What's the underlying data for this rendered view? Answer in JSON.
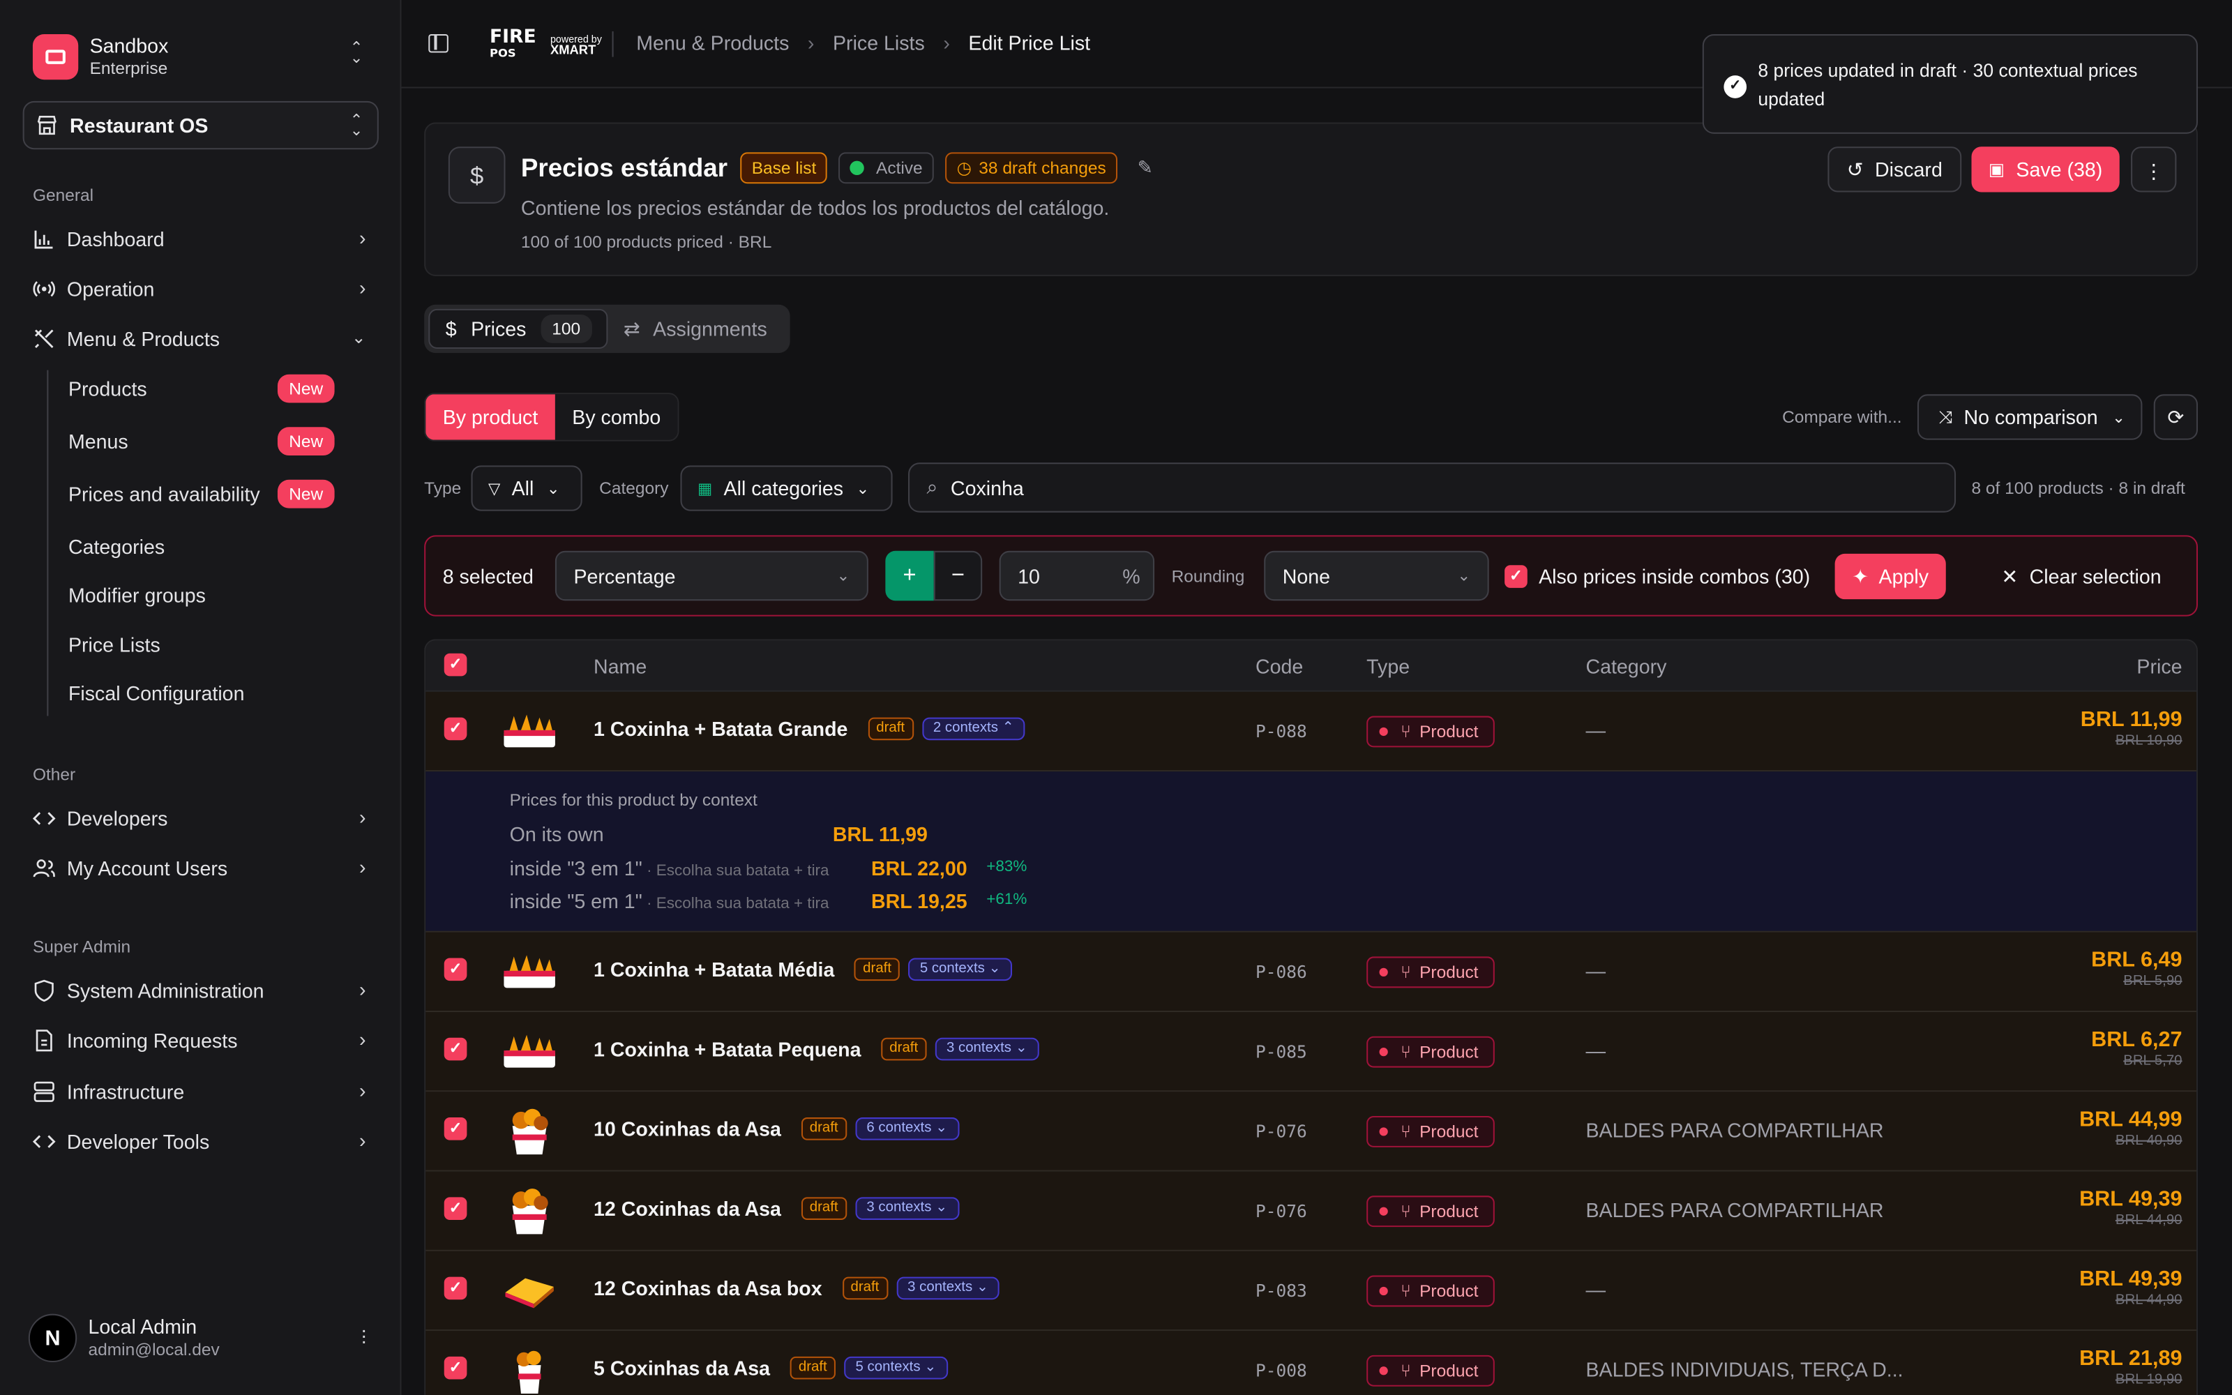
{
  "sidebar": {
    "org_name": "Sandbox",
    "org_plan": "Enterprise",
    "workspace": "Restaurant OS",
    "sections": {
      "general": "General",
      "other": "Other",
      "super_admin": "Super Admin"
    },
    "items": {
      "dashboard": "Dashboard",
      "operation": "Operation",
      "menu_products": "Menu & Products",
      "developers": "Developers",
      "my_account_users": "My Account Users",
      "system_administration": "System Administration",
      "incoming_requests": "Incoming Requests",
      "infrastructure": "Infrastructure",
      "developer_tools": "Developer Tools"
    },
    "subitems": {
      "products": "Products",
      "menus": "Menus",
      "prices_availability": "Prices and availability",
      "categories": "Categories",
      "modifier_groups": "Modifier groups",
      "price_lists": "Price Lists",
      "fiscal_configuration": "Fiscal Configuration"
    },
    "new_badge": "New",
    "user": {
      "name": "Local Admin",
      "email": "admin@local.dev",
      "initial": "N"
    }
  },
  "topbar": {
    "brand": {
      "fire": "FIRE",
      "pos": "POS",
      "powered": "powered by",
      "xmart": "XMART"
    },
    "breadcrumbs": [
      "Menu & Products",
      "Price Lists",
      "Edit Price List"
    ]
  },
  "toast": {
    "message": "8 prices updated in draft · 30 contextual prices updated"
  },
  "header": {
    "icon": "$",
    "title": "Precios estándar",
    "badge_base": "Base list",
    "badge_active": "Active",
    "badge_draft": "38 draft changes",
    "description": "Contiene los precios estándar de todos los productos del catálogo.",
    "meta": "100 of 100 products priced · BRL",
    "discard": "Discard",
    "save": "Save (38)"
  },
  "tabs": {
    "prices": "Prices",
    "prices_count": "100",
    "assignments": "Assignments"
  },
  "view": {
    "by_product": "By product",
    "by_combo": "By combo",
    "compare_label": "Compare with...",
    "compare_value": "No comparison"
  },
  "filters": {
    "type_label": "Type",
    "type_value": "All",
    "category_label": "Category",
    "category_value": "All categories",
    "search_value": "Coxinha",
    "count": "8 of 100 products · 8 in draft"
  },
  "bulk": {
    "selected": "8 selected",
    "mode": "Percentage",
    "plus": "+",
    "minus": "−",
    "amount": "10",
    "unit": "%",
    "rounding_label": "Rounding",
    "rounding_value": "None",
    "also_combos": "Also prices inside combos (30)",
    "apply": "Apply",
    "clear": "Clear selection"
  },
  "table": {
    "headers": {
      "name": "Name",
      "code": "Code",
      "type": "Type",
      "category": "Category",
      "price": "Price"
    },
    "draft_label": "draft",
    "rows": [
      {
        "name": "1 Coxinha + Batata Grande",
        "contexts": "2 contexts",
        "code": "P-088",
        "type": "Product",
        "category": "—",
        "price": "BRL 11,99",
        "old_price": "BRL 10,90"
      },
      {
        "name": "1 Coxinha + Batata Média",
        "contexts": "5 contexts",
        "code": "P-086",
        "type": "Product",
        "category": "—",
        "price": "BRL 6,49",
        "old_price": "BRL 5,90"
      },
      {
        "name": "1 Coxinha + Batata Pequena",
        "contexts": "3 contexts",
        "code": "P-085",
        "type": "Product",
        "category": "—",
        "price": "BRL 6,27",
        "old_price": "BRL 5,70"
      },
      {
        "name": "10 Coxinhas da Asa",
        "contexts": "6 contexts",
        "code": "P-076",
        "type": "Product",
        "category": "BALDES PARA COMPARTILHAR",
        "price": "BRL 44,99",
        "old_price": "BRL 40,90"
      },
      {
        "name": "12 Coxinhas da Asa",
        "contexts": "3 contexts",
        "code": "P-076",
        "type": "Product",
        "category": "BALDES PARA COMPARTILHAR",
        "price": "BRL 49,39",
        "old_price": "BRL 44,90"
      },
      {
        "name": "12 Coxinhas da Asa box",
        "contexts": "3 contexts",
        "code": "P-083",
        "type": "Product",
        "category": "—",
        "price": "BRL 49,39",
        "old_price": "BRL 44,90"
      },
      {
        "name": "5 Coxinhas da Asa",
        "contexts": "5 contexts",
        "code": "P-008",
        "type": "Product",
        "category": "BALDES INDIVIDUAIS, TERÇA D...",
        "price": "BRL 21,89",
        "old_price": "BRL 19,90"
      }
    ],
    "context_panel": {
      "heading": "Prices for this product by context",
      "on_own_label": "On its own",
      "on_own_price": "BRL 11,99",
      "lines": [
        {
          "label": "inside \"3 em 1\"",
          "detail": " · Escolha sua batata + tira",
          "price": "BRL 22,00",
          "delta": "+83%"
        },
        {
          "label": "inside \"5 em 1\"",
          "detail": " · Escolha sua batata + tira",
          "price": "BRL 19,25",
          "delta": "+61%"
        }
      ]
    }
  },
  "colors": {
    "accent": "#f43f5e",
    "price": "#f59e0b",
    "positive": "#10b981",
    "context_badge": "#a5b4fc"
  }
}
